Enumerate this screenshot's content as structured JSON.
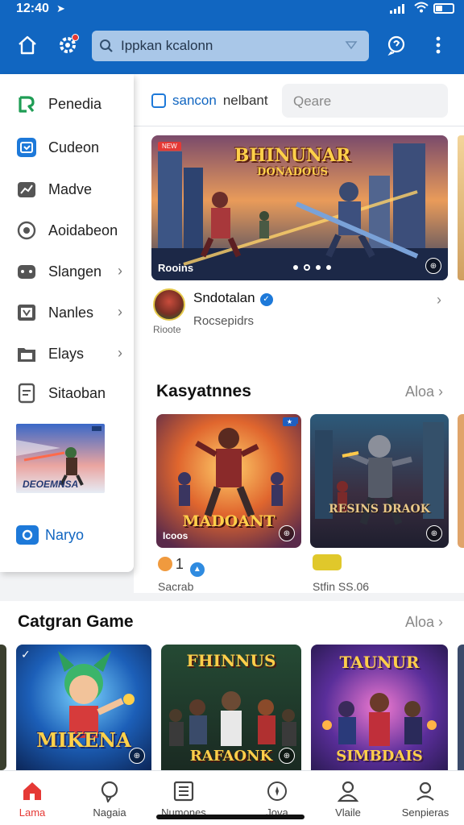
{
  "status_bar": {
    "time": "12:40",
    "location_icon": "location-arrow-icon"
  },
  "header": {
    "search_text": "Ippkan kcalonn",
    "icons": [
      "home-icon",
      "settings-icon",
      "help-icon",
      "more-icon"
    ]
  },
  "sidebar": {
    "items": [
      {
        "label": "Penedia",
        "icon": "brand-logo-icon",
        "chevron": false
      },
      {
        "label": "Cudeon",
        "icon": "calendar-icon",
        "chevron": false
      },
      {
        "label": "Madve",
        "icon": "chart-icon",
        "chevron": false
      },
      {
        "label": "Aoidabeon",
        "icon": "record-icon",
        "chevron": false
      },
      {
        "label": "Slangen",
        "icon": "puzzle-icon",
        "chevron": true
      },
      {
        "label": "Nanles",
        "icon": "screen-icon",
        "chevron": true
      },
      {
        "label": "Elays",
        "icon": "folder-icon",
        "chevron": true
      },
      {
        "label": "Sitaoban",
        "icon": "document-icon",
        "chevron": false
      }
    ],
    "thumb_tag": "NEW",
    "thumb_title": "DEOEMNSA",
    "bottom_label": "Naryo"
  },
  "main": {
    "chip_label": "sancon",
    "chip_secondary": "nelbant",
    "query_placeholder": "Qeare",
    "banner": {
      "tag": "NEW",
      "title_line1": "BHINUNAR",
      "title_line2": "DONADOUS",
      "label": "Rooins",
      "active_dot": 2,
      "dot_count": 4
    },
    "publisher": {
      "name": "Sndotalan",
      "subtitle": "Rocsepidrs",
      "small_label": "Rioote"
    }
  },
  "section1": {
    "title": "Kasyatnnes",
    "see_all": "Aloa",
    "cards": [
      {
        "title": "MADOANT",
        "label": "Icoos",
        "meta": "Sacrab",
        "rating": "1",
        "badge": "orange-blue"
      },
      {
        "title": "RESINS DRAOK",
        "label": "",
        "meta": "Stfin SS.06",
        "badge": "yellow"
      }
    ]
  },
  "section2": {
    "title": "Catgran Game",
    "see_all": "Aloa",
    "cards": [
      {
        "title": "MIKENA"
      },
      {
        "title_top": "FHINNUS",
        "title_bottom": "RAFAONK"
      },
      {
        "title_top": "TAUNUR",
        "title_bottom": "SIMBDAIS"
      }
    ]
  },
  "bottom_nav": {
    "items": [
      {
        "label": "Lama",
        "icon": "home-icon",
        "active": true
      },
      {
        "label": "Nagaia",
        "icon": "chat-icon",
        "active": false
      },
      {
        "label": "Numones",
        "icon": "list-icon",
        "active": false
      },
      {
        "label": "Jova",
        "icon": "compass-icon",
        "active": false
      },
      {
        "label": "Vlaile",
        "icon": "user-icon",
        "active": false
      },
      {
        "label": "Senpieras",
        "icon": "profile-icon",
        "active": false
      }
    ]
  },
  "colors": {
    "accent": "#1166c1",
    "active_nav": "#e53935"
  }
}
